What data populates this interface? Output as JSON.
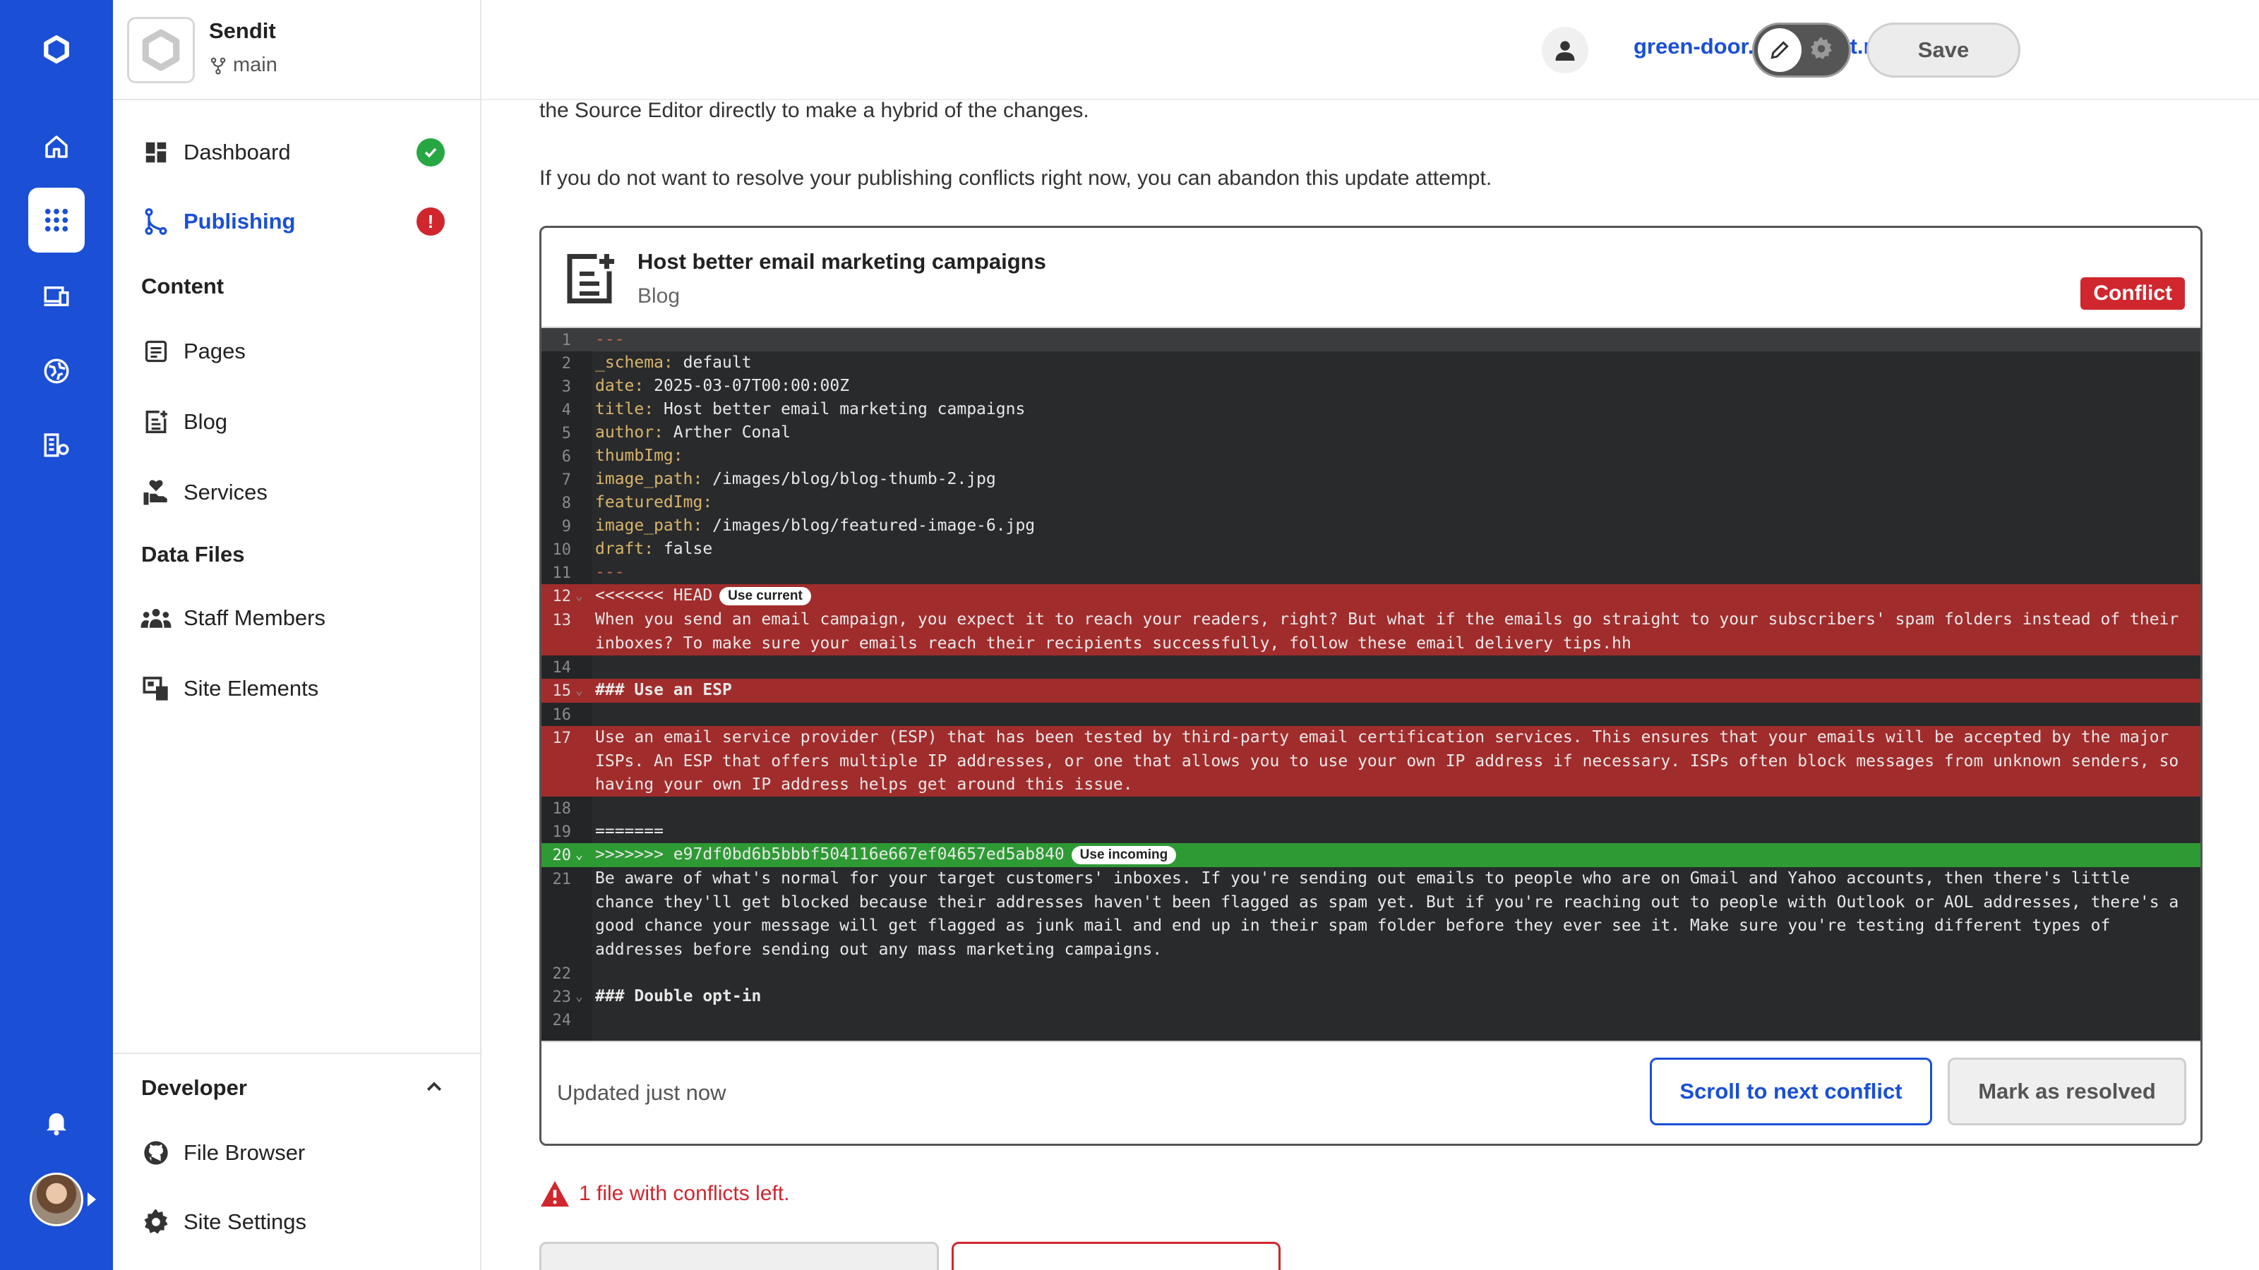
{
  "site": {
    "name": "Sendit",
    "branch": "main"
  },
  "header": {
    "domain": "green-door.cloudvent.net",
    "save_label": "Save"
  },
  "sidebar": {
    "items": [
      {
        "label": "Dashboard"
      },
      {
        "label": "Publishing"
      },
      {
        "label": "Pages"
      },
      {
        "label": "Blog"
      },
      {
        "label": "Services"
      },
      {
        "label": "Staff Members"
      },
      {
        "label": "Site Elements"
      },
      {
        "label": "File Browser"
      },
      {
        "label": "Site Settings"
      }
    ],
    "sections": {
      "content": "Content",
      "data_files": "Data Files"
    },
    "developer": "Developer",
    "publishing_badge": "!"
  },
  "main": {
    "intro1": "the Source Editor directly to make a hybrid of the changes.",
    "intro2": "If you do not want to resolve your publishing conflicts right now, you can abandon this update attempt.",
    "card": {
      "title": "Host better email marketing campaigns",
      "subtitle": "Blog",
      "badge": "Conflict",
      "updated": "Updated just now",
      "next_button": "Scroll to next conflict",
      "resolve_button": "Mark as resolved",
      "pill_current": "Use current",
      "pill_incoming": "Use incoming"
    },
    "code": {
      "l1": "---",
      "l2k": "_schema:",
      "l2v": " default",
      "l3k": "date:",
      "l3v": " 2025-03-07T00:00:00Z",
      "l4k": "title:",
      "l4v": " Host better email marketing campaigns",
      "l5k": "author:",
      "l5v": " Arther Conal",
      "l6k": "thumbImg:",
      "l7k": "image_path:",
      "l7v": " /images/blog/blog-thumb-2.jpg",
      "l8k": "featuredImg:",
      "l9k": "image_path:",
      "l9v": " /images/blog/featured-image-6.jpg",
      "l10k": "draft:",
      "l10v": " false",
      "l11": "---",
      "l12": "<<<<<<< HEAD",
      "l13": "When you send an email campaign, you expect it to reach your readers, right? But what if the emails go straight to your subscribers' spam folders instead of their inboxes? To make sure your emails reach their recipients successfully, follow these email delivery tips.hh",
      "l15": "### Use an ESP",
      "l17": "Use an email service provider (ESP) that has been tested by third-party email certification services. This ensures that your emails will be accepted by the major ISPs. An ESP that offers multiple IP addresses, or one that allows you to use your own IP address if necessary. ISPs often block messages from unknown senders, so having your own IP address helps get around this issue.",
      "l19": "=======",
      "l20": ">>>>>>> e97df0bd6b5bbbf504116e667ef04657ed5ab840",
      "l21": "Be aware of what's normal for your target customers' inboxes. If you're sending out emails to people who are on Gmail and Yahoo accounts, then there's little chance they'll get blocked because their addresses haven't been flagged as spam yet. But if you're reaching out to people with Outlook or AOL addresses, there's a good chance your message will get flagged as junk mail and end up in their spam folder before they ever see it. Make sure you're testing different types of addresses before sending out any mass marketing campaigns.",
      "l23": "### Double opt-in"
    },
    "warning": "1 file with conflicts left."
  },
  "colors": {
    "brand": "#1a4fd6",
    "conflict": "#d0262d",
    "current": "#a12c2c",
    "incoming": "#2e9a34"
  }
}
